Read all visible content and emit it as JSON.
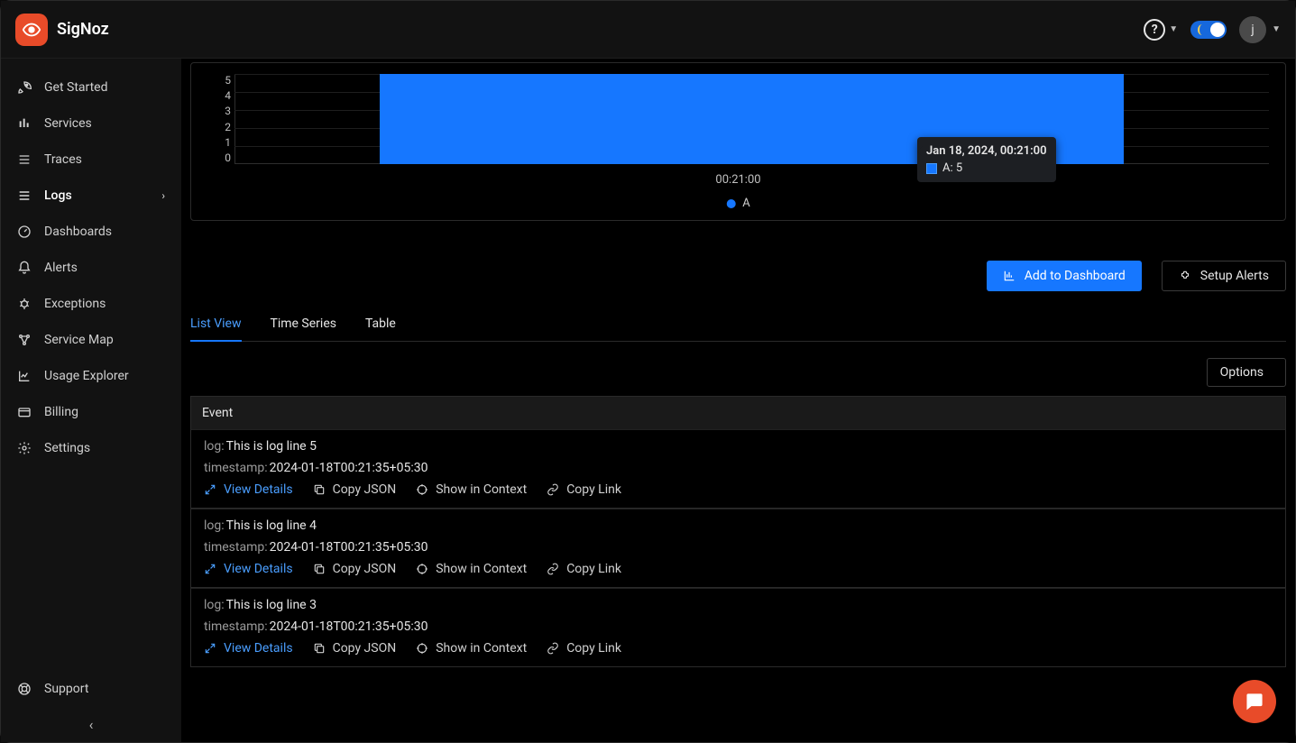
{
  "brand": "SigNoz",
  "header": {
    "avatar_initial": "j"
  },
  "sidebar": {
    "items": [
      {
        "label": "Get Started",
        "name": "get-started",
        "icon": "rocket"
      },
      {
        "label": "Services",
        "name": "services",
        "icon": "bars"
      },
      {
        "label": "Traces",
        "name": "traces",
        "icon": "menu"
      },
      {
        "label": "Logs",
        "name": "logs",
        "icon": "menu",
        "active": true,
        "expandable": true
      },
      {
        "label": "Dashboards",
        "name": "dashboards",
        "icon": "gauge"
      },
      {
        "label": "Alerts",
        "name": "alerts",
        "icon": "bell"
      },
      {
        "label": "Exceptions",
        "name": "exceptions",
        "icon": "bug"
      },
      {
        "label": "Service Map",
        "name": "service-map",
        "icon": "network"
      },
      {
        "label": "Usage Explorer",
        "name": "usage-explorer",
        "icon": "chart"
      },
      {
        "label": "Billing",
        "name": "billing",
        "icon": "card"
      },
      {
        "label": "Settings",
        "name": "settings",
        "icon": "gear"
      }
    ],
    "support_label": "Support"
  },
  "chart_data": {
    "type": "bar",
    "categories": [
      "00:21:00"
    ],
    "series": [
      {
        "name": "A",
        "values": [
          5
        ]
      }
    ],
    "ylim": [
      0,
      5
    ],
    "y_ticks": [
      5,
      4,
      3,
      2,
      1,
      0
    ],
    "x_tick_label": "00:21:00",
    "tooltip": {
      "title": "Jan 18, 2024, 00:21:00",
      "series": "A",
      "value": 5
    },
    "legend": "A",
    "bar_color": "#1677ff"
  },
  "actions": {
    "add_dashboard": "Add to Dashboard",
    "setup_alerts": "Setup Alerts"
  },
  "tabs": [
    {
      "label": "List View",
      "name": "list-view",
      "active": true
    },
    {
      "label": "Time Series",
      "name": "time-series"
    },
    {
      "label": "Table",
      "name": "table"
    }
  ],
  "options_label": "Options",
  "table_header": "Event",
  "log_rows": [
    {
      "log": "This is log line 5",
      "timestamp": "2024-01-18T00:21:35+05:30"
    },
    {
      "log": "This is log line 4",
      "timestamp": "2024-01-18T00:21:35+05:30"
    },
    {
      "log": "This is log line 3",
      "timestamp": "2024-01-18T00:21:35+05:30"
    }
  ],
  "row_actions": {
    "view_details": "View Details",
    "copy_json": "Copy JSON",
    "show_context": "Show in Context",
    "copy_link": "Copy Link"
  },
  "labels": {
    "log_key": "log:",
    "timestamp_key": "timestamp:"
  }
}
